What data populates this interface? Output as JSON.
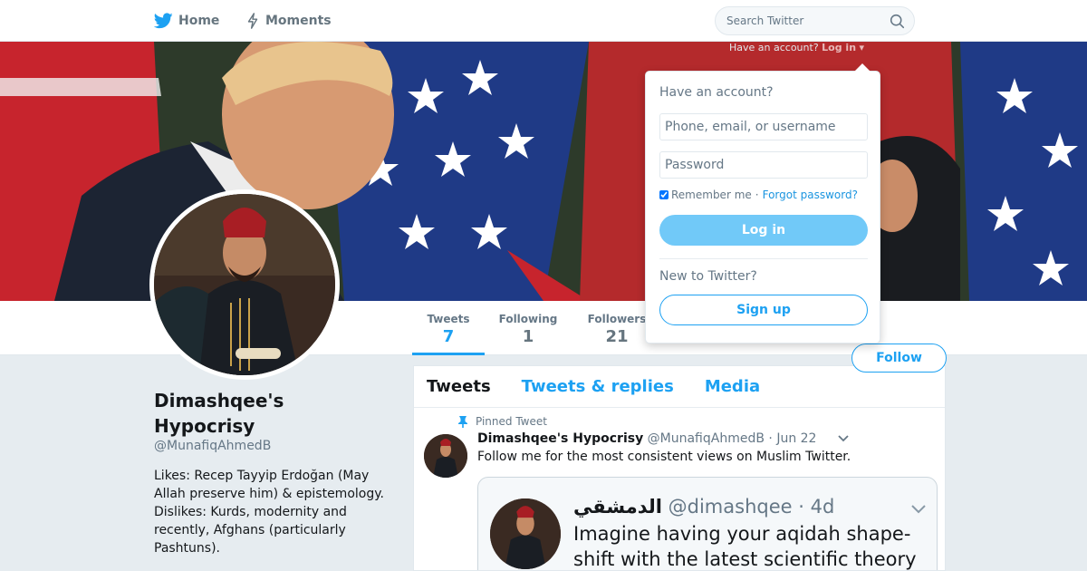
{
  "nav": {
    "home_label": "Home",
    "moments_label": "Moments",
    "search_placeholder": "Search Twitter"
  },
  "login_prompt": {
    "question": "Have an account?",
    "login_label": "Log in"
  },
  "profile": {
    "name": "Dimashqee's Hypocrisy",
    "handle": "@MunafiqAhmedB",
    "bio": "Likes: Recep Tayyip Erdoğan (May Allah preserve him) & epistemology. Dislikes: Kurds, modernity and recently, Afghans (particularly Pashtuns).",
    "follow_label": "Follow"
  },
  "stats": [
    {
      "label": "Tweets",
      "value": "7"
    },
    {
      "label": "Following",
      "value": "1"
    },
    {
      "label": "Followers",
      "value": "21"
    }
  ],
  "tabs": [
    "Tweets",
    "Tweets & replies",
    "Media"
  ],
  "pinned_tweet": {
    "pinned_label": "Pinned Tweet",
    "name": "Dimashqee's Hypocrisy",
    "handle": "@MunafiqAhmedB",
    "date": "· Jun 22",
    "text": "Follow me for the most consistent views on Muslim Twitter.",
    "quote": {
      "name": "الدمشقي",
      "handle": "@dimashqee",
      "date": "· 4d",
      "text": "Imagine having your aqidah shape-shift with the latest scientific theory"
    }
  },
  "login_dropdown": {
    "title": "Have an account?",
    "username_placeholder": "Phone, email, or username",
    "password_placeholder": "Password",
    "remember_label": "Remember me",
    "separator": "·",
    "forgot_label": "Forgot password?",
    "login_button": "Log in",
    "new_label": "New to Twitter?",
    "signup_button": "Sign up"
  },
  "colors": {
    "accent": "#1da1f2",
    "login_button": "#71c9f8",
    "background": "#e6ecf0"
  },
  "icons": [
    "twitter-bird-icon",
    "lightning-icon",
    "search-icon",
    "pin-icon",
    "chevron-down-icon"
  ]
}
